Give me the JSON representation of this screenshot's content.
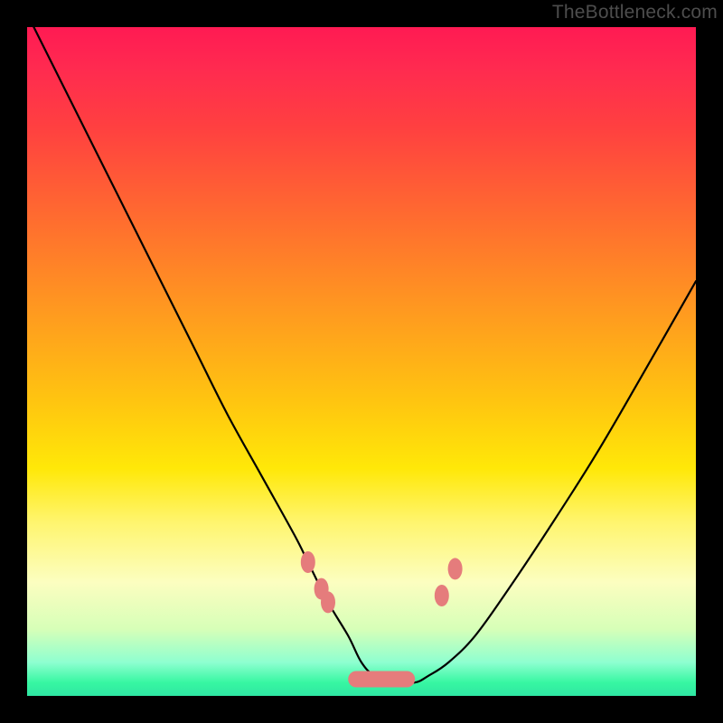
{
  "watermark": "TheBottleneck.com",
  "chart_data": {
    "type": "line",
    "title": "",
    "xlabel": "",
    "ylabel": "",
    "xlim": [
      0,
      100
    ],
    "ylim": [
      0,
      100
    ],
    "grid": false,
    "legend": false,
    "series": [
      {
        "name": "bottleneck-curve",
        "x": [
          1,
          5,
          10,
          15,
          20,
          25,
          30,
          35,
          40,
          42,
          45,
          48,
          50,
          52,
          55,
          58,
          60,
          63,
          67,
          72,
          78,
          85,
          92,
          100
        ],
        "y": [
          100,
          92,
          82,
          72,
          62,
          52,
          42,
          33,
          24,
          20,
          14,
          9,
          5,
          3,
          2,
          2,
          3,
          5,
          9,
          16,
          25,
          36,
          48,
          62
        ]
      }
    ],
    "markers": {
      "name": "highlight-points",
      "color": "#e57c7c",
      "points": [
        {
          "x": 42,
          "y": 20
        },
        {
          "x": 44,
          "y": 16
        },
        {
          "x": 45,
          "y": 14
        },
        {
          "x": 62,
          "y": 15
        },
        {
          "x": 64,
          "y": 19
        }
      ],
      "bar": {
        "x0": 48,
        "x1": 58,
        "y": 2.5
      }
    },
    "background_gradient": {
      "stops": [
        {
          "pos": 0,
          "color": "#ff1a53"
        },
        {
          "pos": 15,
          "color": "#ff4040"
        },
        {
          "pos": 42,
          "color": "#ff9820"
        },
        {
          "pos": 66,
          "color": "#ffe808"
        },
        {
          "pos": 83,
          "color": "#fcfec0"
        },
        {
          "pos": 95,
          "color": "#8effd0"
        },
        {
          "pos": 100,
          "color": "#2fe6a3"
        }
      ]
    }
  }
}
